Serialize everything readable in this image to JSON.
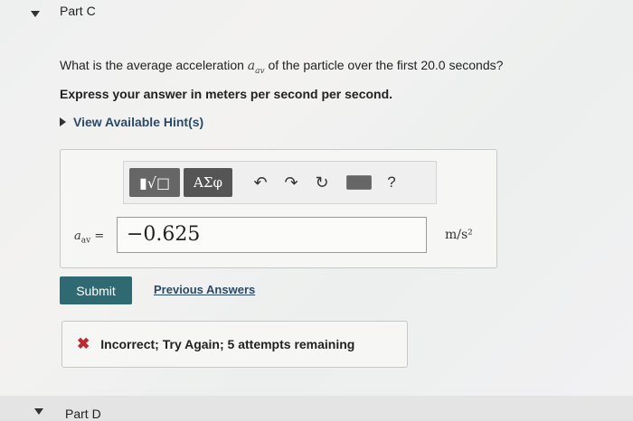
{
  "part_c": {
    "title": "Part C"
  },
  "question": {
    "prefix": "What is the average acceleration ",
    "symbol": "a",
    "subscript": "av",
    "suffix": " of the particle over the first 20.0 seconds?",
    "instruction": "Express your answer in meters per second per second."
  },
  "hint": {
    "label": "View Available Hint(s)"
  },
  "toolbar": {
    "math_template": "▮√□",
    "greek_label": "ΑΣφ",
    "undo_icon": "↶",
    "redo_icon": "↷",
    "reset_icon": "↻",
    "help_label": "?"
  },
  "answer": {
    "var_symbol": "a",
    "var_subscript": "av",
    "equals": " =",
    "value": "−0.625",
    "units": "m/s²"
  },
  "actions": {
    "submit_label": "Submit",
    "previous_answers_label": "Previous Answers"
  },
  "feedback": {
    "icon": "✖",
    "text": "Incorrect; Try Again; 5 attempts remaining"
  },
  "part_d": {
    "title": "Part D"
  }
}
